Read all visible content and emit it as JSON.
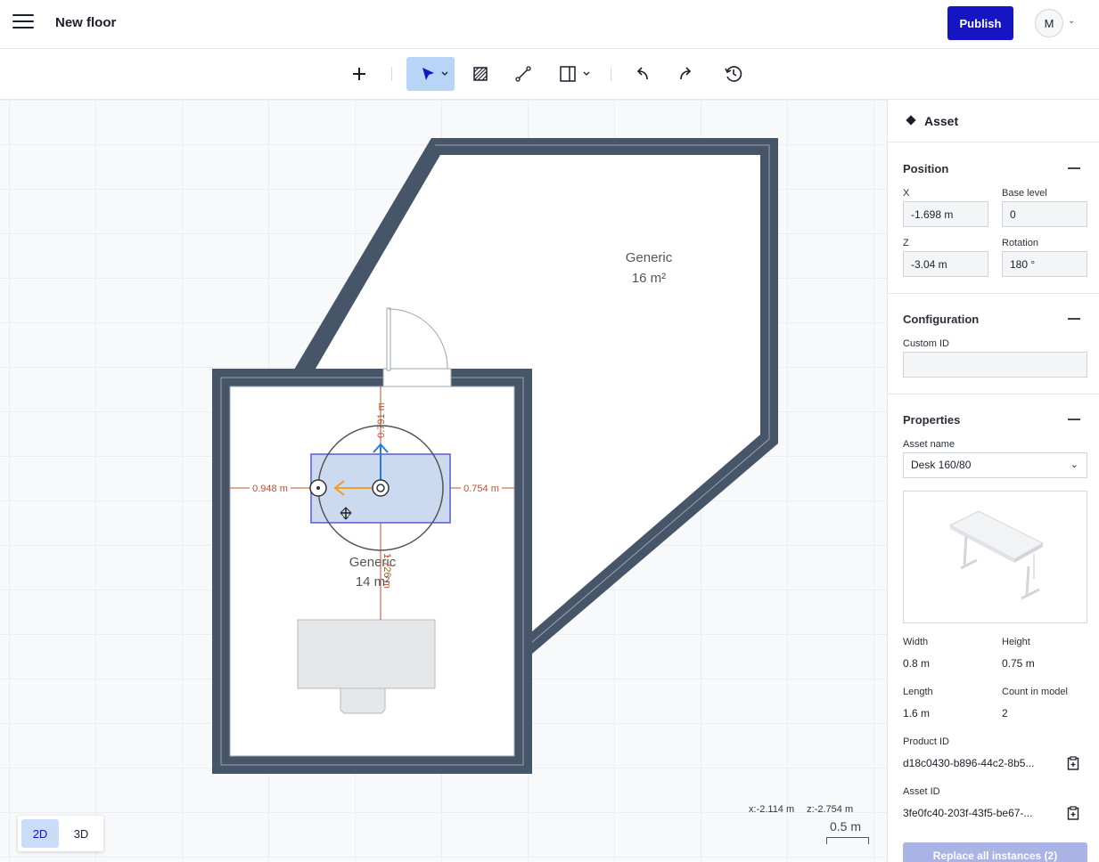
{
  "header": {
    "title": "New floor",
    "publish_label": "Publish",
    "avatar_initial": "M"
  },
  "toolbar": {
    "icons": [
      "plus-icon",
      "pointer-icon",
      "hatch-icon",
      "measure-line-icon",
      "wall-panel-icon",
      "undo-icon",
      "redo-icon",
      "history-icon"
    ],
    "active_tool": "pointer",
    "accent": "#1515c4",
    "active_bg": "#b8d4f7"
  },
  "canvas": {
    "rooms": [
      {
        "name": "Generic",
        "area": "16 m²"
      },
      {
        "name": "Generic",
        "area": "14 m²"
      }
    ],
    "dimensions": {
      "left": "0.948 m",
      "right": "0.754 m",
      "top": "0.791 m",
      "bottom": "1.726 m"
    },
    "cursor": {
      "x": "x:-2.114 m",
      "z": "z:-2.754 m"
    },
    "scale": "0.5 m",
    "modes": [
      "2D",
      "3D"
    ],
    "active_mode": "2D",
    "wall_color": "#475569",
    "selection_color": "#5b5bd6",
    "dimension_color": "#c0502b"
  },
  "panel": {
    "title": "Asset",
    "position": {
      "title": "Position",
      "x_label": "X",
      "x_value": "-1.698 m",
      "base_level_label": "Base level",
      "base_level_value": "0",
      "z_label": "Z",
      "z_value": "-3.04 m",
      "rotation_label": "Rotation",
      "rotation_value": "180 °"
    },
    "configuration": {
      "title": "Configuration",
      "custom_id_label": "Custom ID",
      "custom_id_value": ""
    },
    "properties": {
      "title": "Properties",
      "asset_name_label": "Asset name",
      "asset_name_value": "Desk 160/80",
      "width_label": "Width",
      "width_value": "0.8 m",
      "height_label": "Height",
      "height_value": "0.75 m",
      "length_label": "Length",
      "length_value": "1.6 m",
      "count_label": "Count in model",
      "count_value": "2",
      "product_id_label": "Product ID",
      "product_id_value": "d18c0430-b896-44c2-8b5...",
      "asset_id_label": "Asset ID",
      "asset_id_value": "3fe0fc40-203f-43f5-be67-...",
      "replace_label": "Replace all instances (2)"
    }
  }
}
